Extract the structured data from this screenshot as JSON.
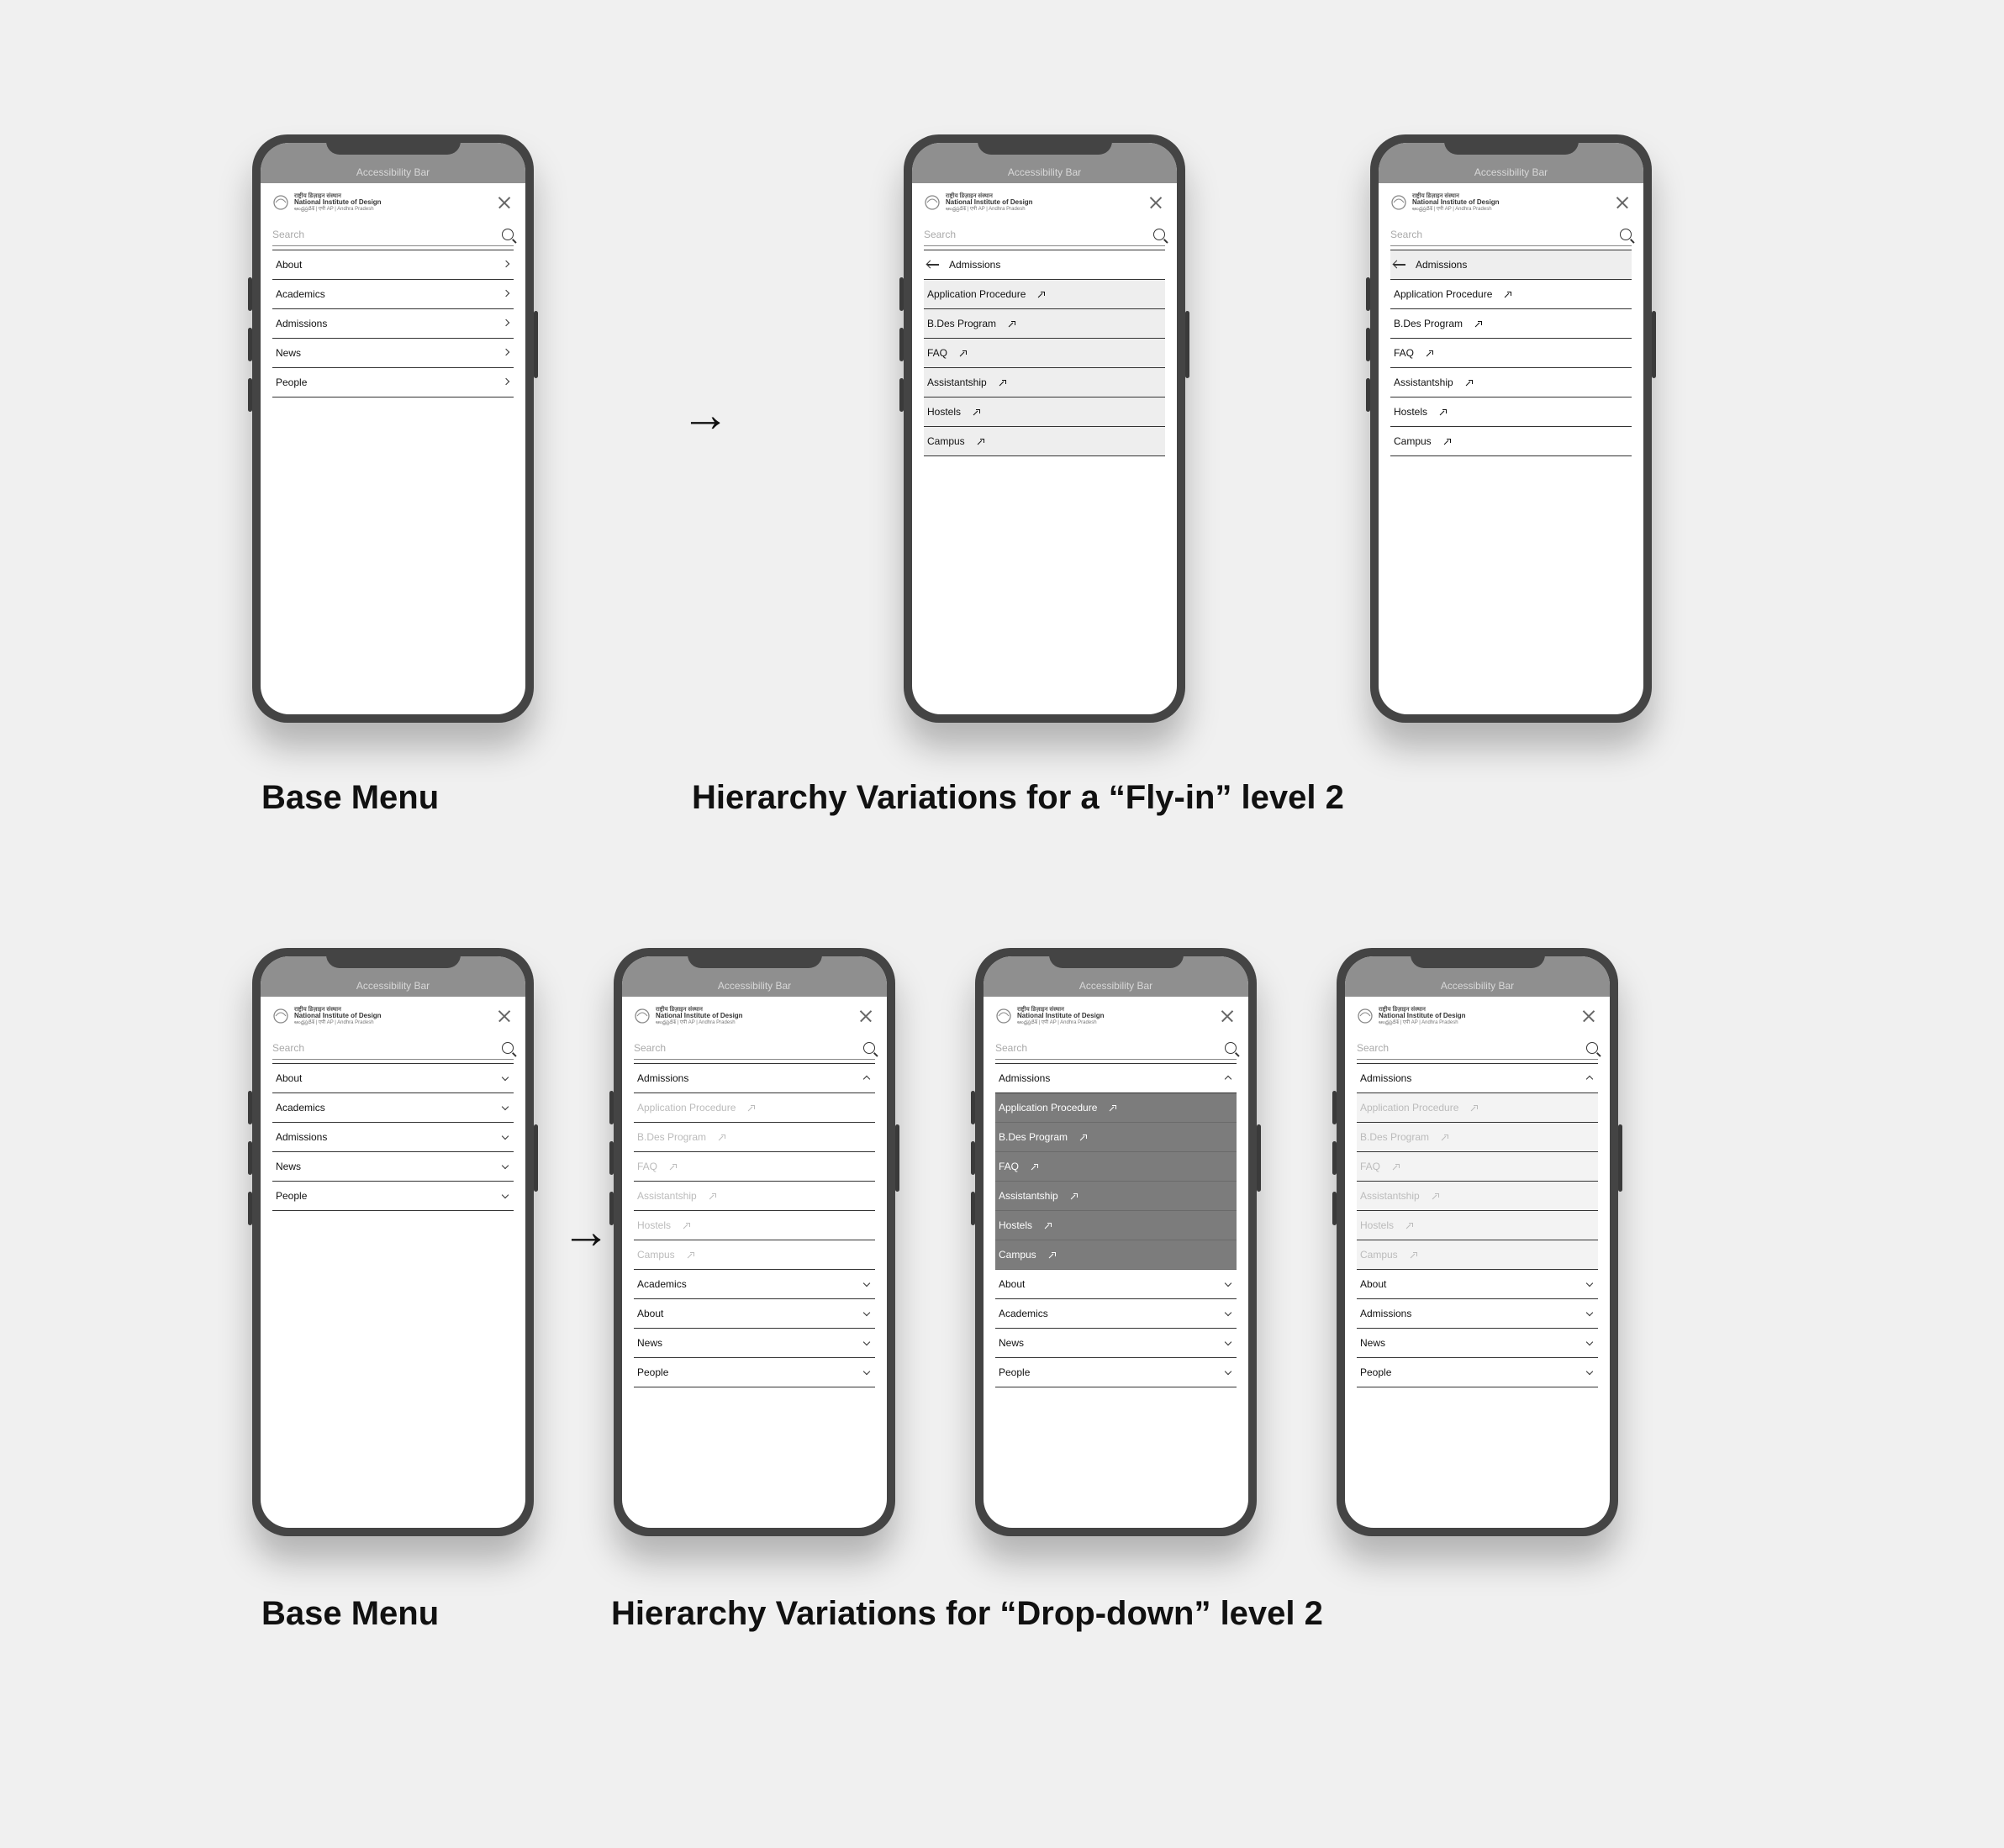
{
  "common": {
    "accessibility_bar": "Accessibility Bar",
    "logo_line1": "राष्ट्रीय डिज़ाइन संस्थान",
    "logo_line2": "National Institute of Design",
    "logo_line3": "ఆంధ్రప్రదేశ్ | एपी AP | Andhra Pradesh",
    "search_placeholder": "Search"
  },
  "base_menu": [
    "About",
    "Academics",
    "Admissions",
    "News",
    "People"
  ],
  "flyin": {
    "header": "Admissions",
    "subitems": [
      "Application Procedure",
      "B.Des Program",
      "FAQ",
      "Assistantship",
      "Hostels",
      "Campus"
    ]
  },
  "dropdown": {
    "expanded": "Admissions",
    "subitems": [
      "Application Procedure",
      "B.Des Program",
      "FAQ",
      "Assistantship",
      "Hostels",
      "Campus"
    ],
    "rest_a": [
      "Academics",
      "About",
      "News",
      "People"
    ],
    "rest_b": [
      "About",
      "Academics",
      "News",
      "People"
    ],
    "rest_c": [
      "About",
      "Admissions",
      "News",
      "People"
    ]
  },
  "captions": {
    "base": "Base Menu",
    "flyin": "Hierarchy Variations for a “Fly-in” level 2",
    "dropdown": "Hierarchy Variations for “Drop-down” level 2"
  },
  "arrow": "→"
}
